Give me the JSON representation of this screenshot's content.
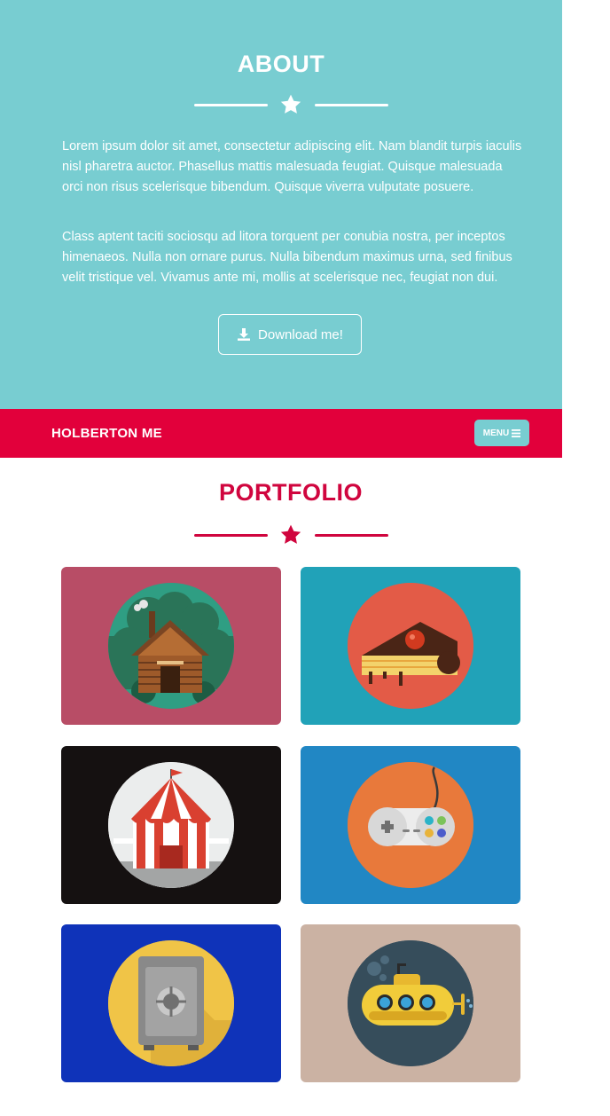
{
  "about": {
    "title": "ABOUT",
    "paragraph_1": "Lorem ipsum dolor sit amet, consectetur adipiscing elit. Nam blandit turpis iaculis nisl pharetra auctor. Phasellus mattis malesuada feugiat. Quisque malesuada orci non risus scelerisque bibendum. Quisque viverra vulputate posuere.",
    "paragraph_2": "Class aptent taciti sociosqu ad litora torquent per conubia nostra, per inceptos himenaeos. Nulla non ornare purus. Nulla bibendum maximus urna, sed finibus velit tristique vel. Vivamus ante mi, mollis at scelerisque nec, feugiat non dui.",
    "download_label": "Download me!",
    "download_icon": "download-icon"
  },
  "navbar": {
    "brand": "HOLBERTON ME",
    "menu_label": "MENU",
    "menu_icon": "hamburger-icon"
  },
  "portfolio": {
    "title": "PORTFOLIO",
    "items": [
      {
        "icon": "log-cabin-icon",
        "bg": "#b84d66",
        "circle": "#2f9e83"
      },
      {
        "icon": "cake-slice-icon",
        "bg": "#21a2b8",
        "circle": "#e35b47"
      },
      {
        "icon": "circus-tent-icon",
        "bg": "#151111",
        "circle": "#ebeded"
      },
      {
        "icon": "game-controller-icon",
        "bg": "#2187c4",
        "circle": "#e8793b"
      },
      {
        "icon": "safe-icon",
        "bg": "#0f33b9",
        "circle": "#f0c447"
      },
      {
        "icon": "submarine-icon",
        "bg": "#cbb2a3",
        "circle": "#364d5b"
      }
    ]
  },
  "colors": {
    "about_bg": "#78cdd1",
    "navbar_bg": "#e2003b",
    "accent": "#d0053e"
  }
}
